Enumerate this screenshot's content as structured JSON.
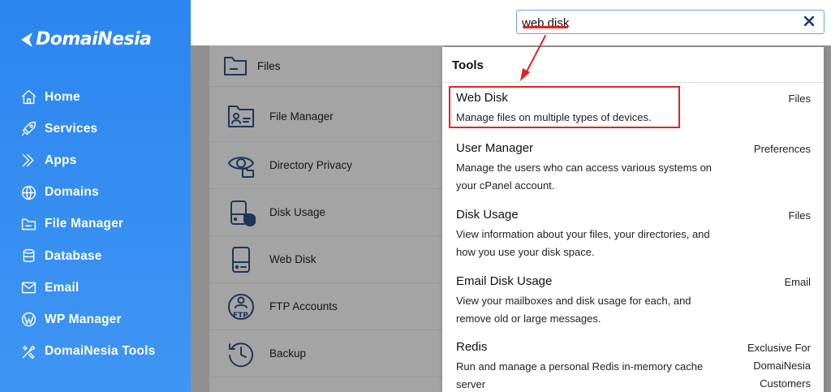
{
  "brand": {
    "name": "DomaiNesia"
  },
  "sidebar": {
    "items": [
      {
        "label": "Home",
        "icon": "home-icon"
      },
      {
        "label": "Services",
        "icon": "rocket-icon"
      },
      {
        "label": "Apps",
        "icon": "apps-icon"
      },
      {
        "label": "Domains",
        "icon": "globe-icon"
      },
      {
        "label": "File Manager",
        "icon": "folder-icon"
      },
      {
        "label": "Database",
        "icon": "database-icon"
      },
      {
        "label": "Email",
        "icon": "envelope-icon"
      },
      {
        "label": "WP Manager",
        "icon": "wordpress-icon"
      },
      {
        "label": "DomaiNesia Tools",
        "icon": "tools-icon"
      }
    ]
  },
  "search": {
    "value": "web disk"
  },
  "files": {
    "header": "Files",
    "tools": [
      {
        "label": "File Manager",
        "icon": "file-manager-icon"
      },
      {
        "label": "Directory Privacy",
        "icon": "eye-folder-icon"
      },
      {
        "label": "Disk Usage",
        "icon": "disk-usage-icon"
      },
      {
        "label": "Web Disk",
        "icon": "web-disk-icon"
      },
      {
        "label": "FTP Accounts",
        "icon": "ftp-icon"
      },
      {
        "label": "Backup",
        "icon": "backup-clock-icon"
      }
    ]
  },
  "results": {
    "title": "Tools",
    "items": [
      {
        "title": "Web Disk",
        "description": "Manage files on multiple types of devices.",
        "category": "Files"
      },
      {
        "title": "User Manager",
        "description": "Manage the users who can access various systems on your cPanel account.",
        "category": "Preferences"
      },
      {
        "title": "Disk Usage",
        "description": "View information about your files, your directories, and how you use your disk space.",
        "category": "Files"
      },
      {
        "title": "Email Disk Usage",
        "description": "View your mailboxes and disk usage for each, and remove old or large messages.",
        "category": "Email"
      },
      {
        "title": "Redis",
        "description": "Run and manage a personal Redis in-memory cache server",
        "category": "Exclusive For DomaiNesia Customers"
      }
    ]
  },
  "colors": {
    "sidebar": "#2c86f0",
    "highlight": "#e02424",
    "accent_border": "#6aa6e8"
  }
}
